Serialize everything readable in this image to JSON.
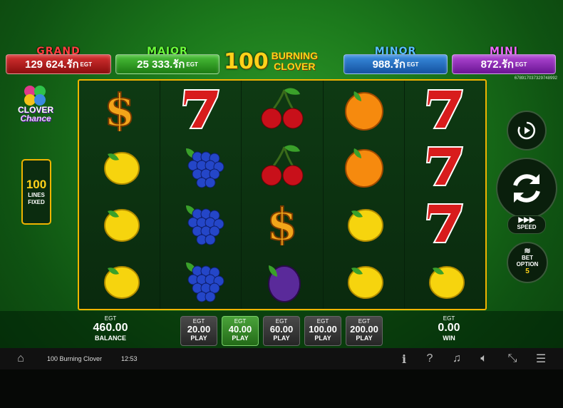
{
  "jackpots": [
    {
      "name": "GRAND",
      "value": "129 624.",
      "unit": "รัก",
      "cur": "EGT"
    },
    {
      "name": "MAJOR",
      "value": "25 333.",
      "unit": "รัก",
      "cur": "EGT"
    },
    {
      "name": "MINOR",
      "value": "988.",
      "unit": "รัก",
      "cur": "EGT"
    },
    {
      "name": "MINI",
      "value": "872.",
      "unit": "รัก",
      "cur": "EGT"
    }
  ],
  "title": {
    "number": "100",
    "line1": "BURNING",
    "line2": "CLOVER"
  },
  "ticket_id": "678917037329748992",
  "logo": {
    "line1": "CLOVER",
    "line2": "Chance"
  },
  "lines": {
    "number": "100",
    "line1": "LINES",
    "line2": "FIXED"
  },
  "reels": [
    [
      "dollar",
      "lemon",
      "lemon",
      "lemon"
    ],
    [
      "seven",
      "grapes",
      "grapes",
      "grapes"
    ],
    [
      "cherry",
      "cherry",
      "dollar",
      "plum"
    ],
    [
      "orange",
      "orange",
      "lemon",
      "lemon"
    ],
    [
      "seven",
      "seven",
      "seven",
      "lemon"
    ]
  ],
  "controls": {
    "speed_label": "SPEED",
    "bet_option_label1": "BET",
    "bet_option_label2": "OPTION",
    "bet_option_value": "5"
  },
  "balance": {
    "currency": "EGT",
    "value": "460.00",
    "label": "BALANCE"
  },
  "win": {
    "currency": "EGT",
    "value": "0.00",
    "label": "WIN"
  },
  "bets": [
    {
      "currency": "EGT",
      "value": "20.00",
      "label": "PLAY",
      "selected": false
    },
    {
      "currency": "EGT",
      "value": "40.00",
      "label": "PLAY",
      "selected": true
    },
    {
      "currency": "EGT",
      "value": "60.00",
      "label": "PLAY",
      "selected": false
    },
    {
      "currency": "EGT",
      "value": "100.00",
      "label": "PLAY",
      "selected": false
    },
    {
      "currency": "EGT",
      "value": "200.00",
      "label": "PLAY",
      "selected": false
    }
  ],
  "system": {
    "game_name": "100 Burning Clover",
    "time": "12:53"
  },
  "icons": [
    "home-icon",
    "info-icon",
    "help-icon",
    "music-off-icon",
    "sound-off-icon",
    "fullscreen-exit-icon",
    "menu-icon"
  ]
}
